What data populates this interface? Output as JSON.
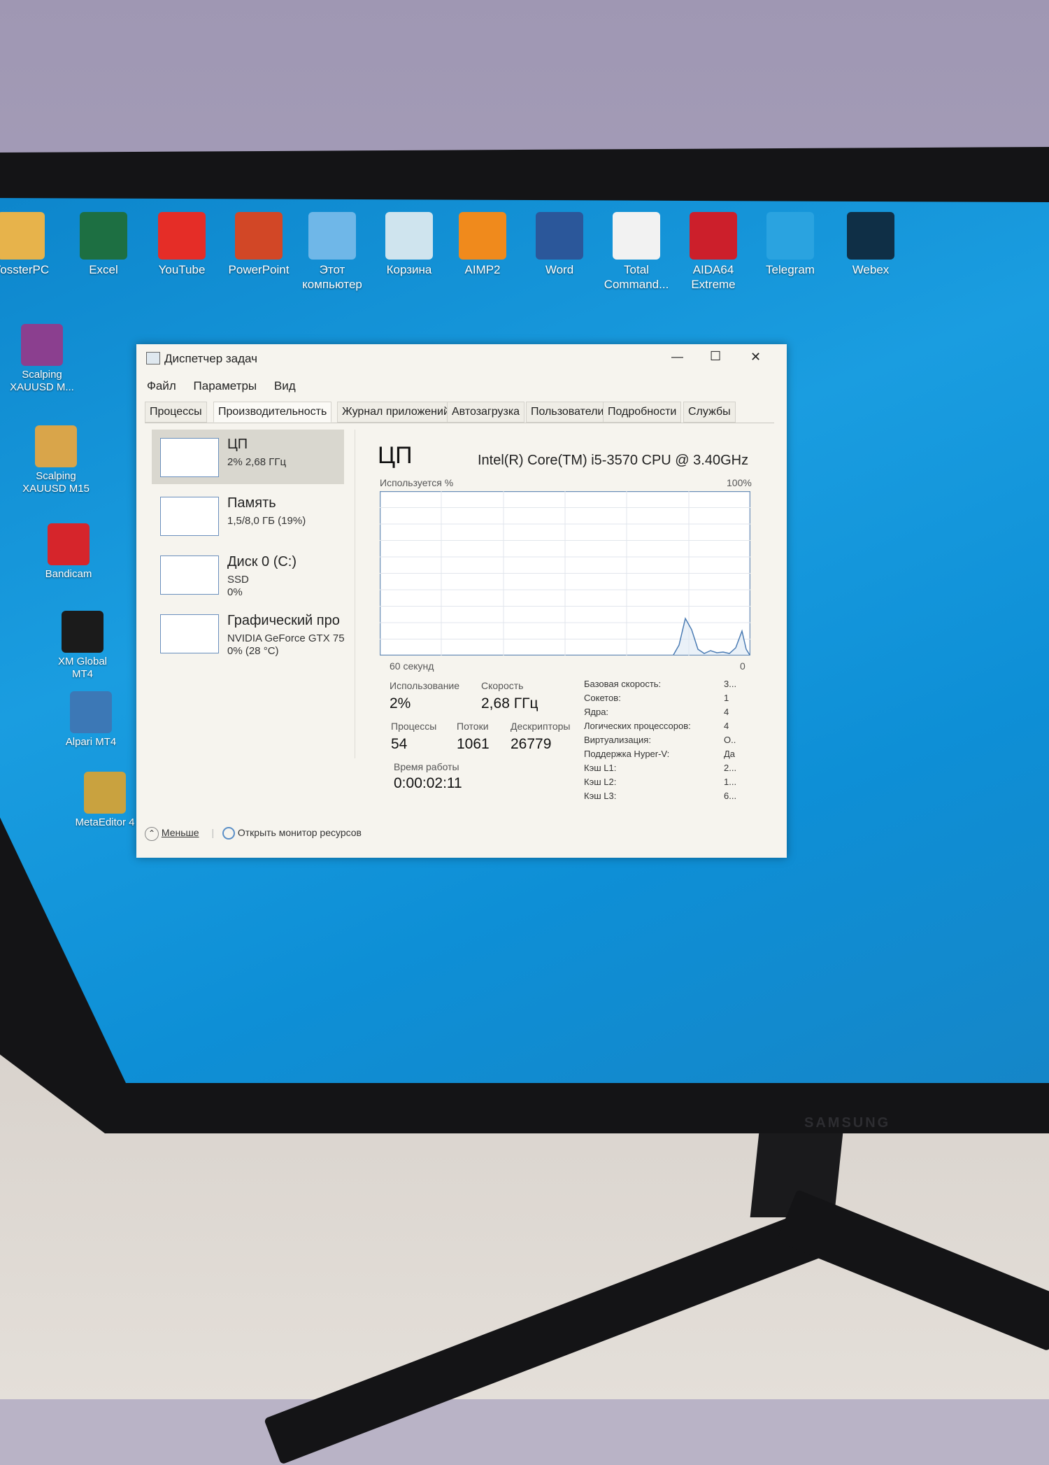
{
  "desktop": {
    "top_icons": [
      {
        "label": "VossterPC",
        "icon": "user-folder-icon",
        "color": "#e7b34b"
      },
      {
        "label": "Excel",
        "icon": "excel-icon",
        "color": "#1d6f42"
      },
      {
        "label": "YouTube",
        "icon": "youtube-icon",
        "color": "#e52d27"
      },
      {
        "label": "PowerPoint",
        "icon": "powerpoint-icon",
        "color": "#d24726"
      },
      {
        "label": "Этот компьютер",
        "icon": "computer-icon",
        "color": "#6fb7e8"
      },
      {
        "label": "Корзина",
        "icon": "recycle-bin-icon",
        "color": "#cfe4ee"
      },
      {
        "label": "AIMP2",
        "icon": "aimp-icon",
        "color": "#f08a1c"
      },
      {
        "label": "Word",
        "icon": "word-icon",
        "color": "#2b579a"
      },
      {
        "label": "Total Command...",
        "icon": "total-commander-icon",
        "color": "#f2f2f2"
      },
      {
        "label": "AIDA64 Extreme",
        "icon": "aida64-icon",
        "color": "#cc1f2b"
      },
      {
        "label": "Telegram",
        "icon": "telegram-icon",
        "color": "#2aa3e0"
      },
      {
        "label": "Webex",
        "icon": "webex-icon",
        "color": "#0f2f46"
      }
    ],
    "left_icons": [
      {
        "label": "Scalping XAUUSD M...",
        "icon": "winrar-icon",
        "color": "#8b3f8f"
      },
      {
        "label": "Scalping XAUUSD M15",
        "icon": "folder-icon",
        "color": "#d9a54a"
      },
      {
        "label": "Bandicam",
        "icon": "bandicam-icon",
        "color": "#d6252b"
      },
      {
        "label": "XM Global MT4",
        "icon": "xm-icon",
        "color": "#1b1b1b"
      },
      {
        "label": "Alpari MT4",
        "icon": "alpari-icon",
        "color": "#3c78b6"
      },
      {
        "label": "MetaEditor 4",
        "icon": "metaeditor-icon",
        "color": "#c9a23f"
      }
    ]
  },
  "monitor": {
    "brand": "SAMSUNG"
  },
  "window": {
    "title": "Диспетчер задач",
    "minimize": "—",
    "maximize": "☐",
    "close": "✕",
    "menu": [
      "Файл",
      "Параметры",
      "Вид"
    ],
    "tabs": [
      "Процессы",
      "Производительность",
      "Журнал приложений",
      "Автозагрузка",
      "Пользователи",
      "Подробности",
      "Службы"
    ],
    "active_tab": "Производительность",
    "sidebar": [
      {
        "title": "ЦП",
        "sub1": "2% 2,68 ГГц",
        "sub2": ""
      },
      {
        "title": "Память",
        "sub1": "1,5/8,0 ГБ (19%)",
        "sub2": ""
      },
      {
        "title": "Диск 0 (C:)",
        "sub1": "SSD",
        "sub2": "0%"
      },
      {
        "title": "Графический про",
        "sub1": "NVIDIA GeForce GTX 75(",
        "sub2": "0% (28 °C)"
      }
    ],
    "main": {
      "title": "ЦП",
      "cpu_model": "Intel(R) Core(TM) i5-3570 CPU @ 3.40GHz",
      "graph_label": "Используется %",
      "graph_max": "100%",
      "graph_time": "60 секунд",
      "graph_zero": "0",
      "usage_label": "Использование",
      "usage_value": "2%",
      "speed_label": "Скорость",
      "speed_value": "2,68 ГГц",
      "processes_label": "Процессы",
      "processes_value": "54",
      "threads_label": "Потоки",
      "threads_value": "1061",
      "handles_label": "Дескрипторы",
      "handles_value": "26779",
      "uptime_label": "Время работы",
      "uptime_value": "0:00:02:11",
      "specs": [
        {
          "k": "Базовая скорость:",
          "v": "3..."
        },
        {
          "k": "Сокетов:",
          "v": "1"
        },
        {
          "k": "Ядра:",
          "v": "4"
        },
        {
          "k": "Логических процессоров:",
          "v": "4"
        },
        {
          "k": "Виртуализация:",
          "v": "О.."
        },
        {
          "k": "Поддержка Hyper-V:",
          "v": "Да"
        },
        {
          "k": "Кэш L1:",
          "v": "2..."
        },
        {
          "k": "Кэш L2:",
          "v": "1..."
        },
        {
          "k": "Кэш L3:",
          "v": "6..."
        }
      ]
    },
    "footer": {
      "less": "Меньше",
      "resmon": "Открыть монитор ресурсов"
    }
  }
}
